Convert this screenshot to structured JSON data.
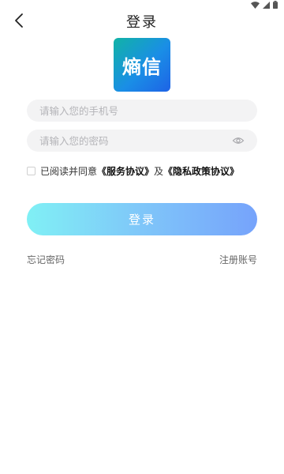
{
  "status_bar": {
    "icons": [
      "wifi-icon",
      "signal-icon",
      "battery-icon"
    ]
  },
  "nav": {
    "back_icon": "chevron-left-icon",
    "title": "登录"
  },
  "logo": {
    "text": "熵信",
    "colors": [
      "#11b3a6",
      "#1a8ee6",
      "#1e63e6"
    ]
  },
  "form": {
    "phone": {
      "placeholder": "请输入您的手机号",
      "value": ""
    },
    "password": {
      "placeholder": "请输入您的密码",
      "value": "",
      "toggle_icon": "eye-icon"
    }
  },
  "agreement": {
    "checked": false,
    "prefix": "已阅读并同意",
    "service_link": "《服务协议》",
    "conjunction": "及",
    "privacy_link": "《隐私政策协议》"
  },
  "login_button": {
    "label": "登录",
    "gradient": [
      "#80f0f5",
      "#7fc6f9",
      "#76a3fb"
    ]
  },
  "links": {
    "forgot_password": "忘记密码",
    "register": "注册账号"
  }
}
